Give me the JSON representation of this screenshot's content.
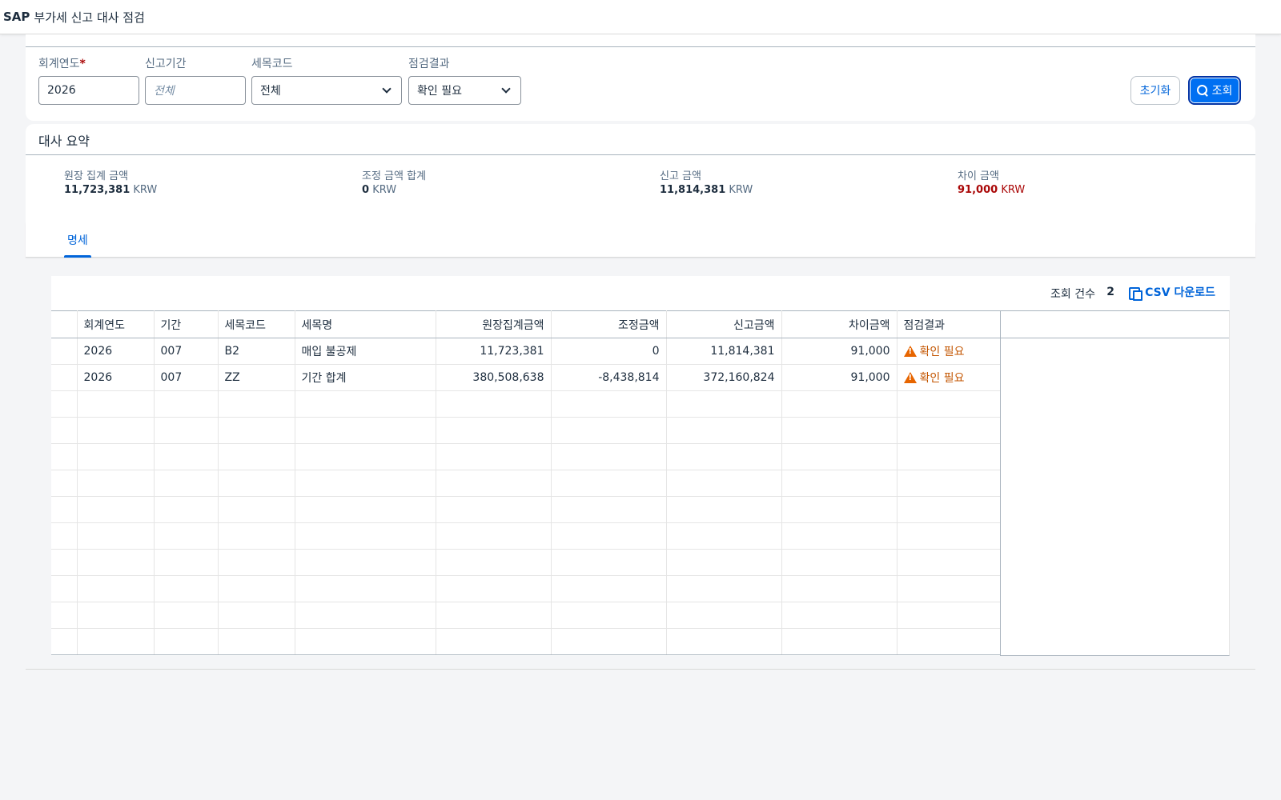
{
  "shell": {
    "brand": "SAP",
    "title": "부가세 신고 대사 점검"
  },
  "filters": {
    "fiscal_year": {
      "label": "회계연도",
      "required_mark": "*",
      "value": "2026"
    },
    "period": {
      "label": "신고기간",
      "placeholder": "전체",
      "value": ""
    },
    "tax_code": {
      "label": "세목코드",
      "value": "전체"
    },
    "check_result": {
      "label": "점검결과",
      "value": "확인 필요"
    },
    "reset_label": "초기화",
    "go_label": "조회"
  },
  "summary": {
    "title": "대사 요약",
    "kpis": [
      {
        "label": "원장 집계 금액",
        "value": "11,723,381",
        "unit": "KRW"
      },
      {
        "label": "조정 금액 합계",
        "value": "0",
        "unit": "KRW"
      },
      {
        "label": "신고 금액",
        "value": "11,814,381",
        "unit": "KRW"
      },
      {
        "label": "차이 금액",
        "value": "91,000",
        "unit": "KRW",
        "status_color": "#aa0808"
      }
    ]
  },
  "tabs": [
    {
      "label": "명세",
      "selected": true
    }
  ],
  "table": {
    "count_label": "조회 건수",
    "count_value": "2",
    "csv_label": "CSV 다운로드",
    "columns": [
      "회계연도",
      "기간",
      "세목코드",
      "세목명",
      "원장집계금액",
      "조정금액",
      "신고금액",
      "차이금액",
      "점검결과"
    ],
    "rows": [
      [
        "2026",
        "007",
        "B2",
        "매입 불공제",
        "11,723,381",
        "0",
        "11,814,381",
        "91,000",
        "확인 필요"
      ],
      [
        "2026",
        "007",
        "ZZ",
        "기간 합계",
        "380,508,638",
        "-8,438,814",
        "372,160,824",
        "91,000",
        "확인 필요"
      ]
    ],
    "empty_rows": 10
  },
  "colors": {
    "accent": "#0064d9",
    "button": "#0070f2",
    "warning": "#e76500",
    "negative": "#aa0808"
  }
}
